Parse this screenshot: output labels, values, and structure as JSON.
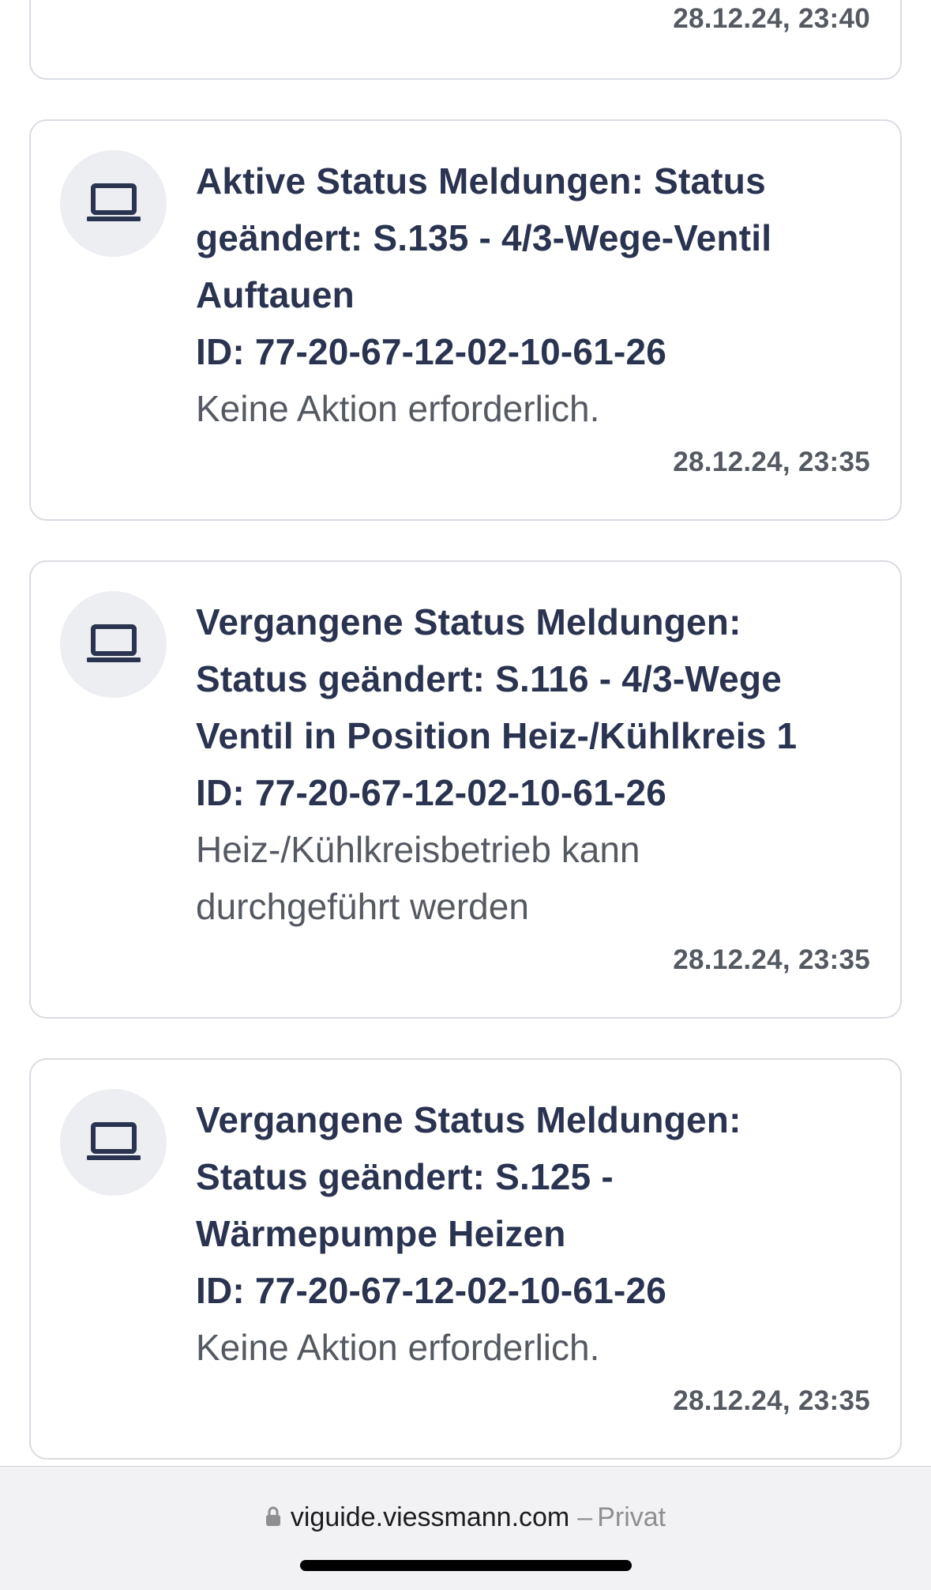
{
  "partial_card": {
    "timestamp": "28.12.24, 23:40"
  },
  "notifications": [
    {
      "title_lines": [
        "Aktive Status Meldungen: Status",
        "geändert: S.135 - 4/3-Wege-Ventil",
        "Auftauen"
      ],
      "id_line": "ID: 77-20-67-12-02-10-61-26",
      "desc_lines": [
        "Keine Aktion erforderlich."
      ],
      "timestamp": "28.12.24, 23:35",
      "icon": "laptop-icon"
    },
    {
      "title_lines": [
        "Vergangene Status Meldungen:",
        "Status geändert: S.116 - 4/3-Wege",
        "Ventil in Position Heiz-/Kühlkreis 1"
      ],
      "id_line": "ID: 77-20-67-12-02-10-61-26",
      "desc_lines": [
        "Heiz-/Kühlkreisbetrieb kann",
        "durchgeführt werden"
      ],
      "timestamp": "28.12.24, 23:35",
      "icon": "laptop-icon"
    },
    {
      "title_lines": [
        "Vergangene Status Meldungen:",
        "Status geändert: S.125 -",
        "Wärmepumpe Heizen"
      ],
      "id_line": "ID: 77-20-67-12-02-10-61-26",
      "desc_lines": [
        "Keine Aktion erforderlich."
      ],
      "timestamp": "28.12.24, 23:35",
      "icon": "laptop-icon"
    }
  ],
  "browser_bar": {
    "url": "viguide.viessmann.com",
    "separator": "–",
    "mode": "Privat",
    "icon": "lock-icon"
  },
  "colors": {
    "title": "#2a3350",
    "body_text": "#555a62",
    "card_border": "#d9dce2",
    "icon_circle": "#eceef1"
  }
}
